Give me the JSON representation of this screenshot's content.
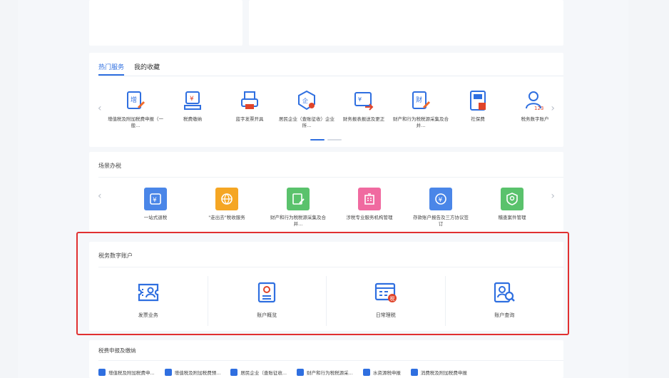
{
  "tabs": {
    "hot": "热门服务",
    "fav": "我的收藏"
  },
  "hot_items": [
    {
      "label": "增值税及附加税费申报（一般...",
      "icon": "tax-declare-icon"
    },
    {
      "label": "税费缴纳",
      "icon": "tax-payment-icon"
    },
    {
      "label": "蓝字发票开具",
      "icon": "invoice-print-icon"
    },
    {
      "label": "居民企业（查账征收）企业所...",
      "icon": "enterprise-tax-icon"
    },
    {
      "label": "财务报表报送及更正",
      "icon": "financial-report-icon"
    },
    {
      "label": "财产和行为税税源采集及合并...",
      "icon": "property-tax-icon"
    },
    {
      "label": "社保费",
      "icon": "social-security-icon"
    },
    {
      "label": "税务数字账户",
      "icon": "digital-account-icon"
    }
  ],
  "scene": {
    "title": "场景办税",
    "items": [
      {
        "label": "一站式退税",
        "color": "#4a86e8",
        "icon": "refund-icon"
      },
      {
        "label": "\"走出去\"税收服务",
        "color": "#f5a623",
        "icon": "global-icon"
      },
      {
        "label": "财产和行为税税源采集及合并...",
        "color": "#5ac26c",
        "icon": "property-collect-icon"
      },
      {
        "label": "涉税专业服务机构管理",
        "color": "#f06aa0",
        "icon": "institution-icon"
      },
      {
        "label": "存款账户报告及三方协议签订",
        "color": "#4a86e8",
        "icon": "bank-account-icon"
      },
      {
        "label": "稽查案件管理",
        "color": "#5ac26c",
        "icon": "case-icon"
      }
    ]
  },
  "digital": {
    "title": "税务数字账户",
    "items": [
      {
        "label": "发票业务",
        "icon": "invoice-business-icon"
      },
      {
        "label": "账户概览",
        "icon": "account-overview-icon"
      },
      {
        "label": "日常理税",
        "icon": "daily-tax-icon"
      },
      {
        "label": "账户查询",
        "icon": "account-query-icon"
      }
    ]
  },
  "tax_section": {
    "title": "税费申报及缴纳",
    "links": [
      "增值税及附加税费申...",
      "增值税及附加税费预...",
      "居民企业（查账征收...",
      "财产和行为税税源采...",
      "水资源税申报",
      "消费税及附加税费申报"
    ]
  },
  "colors": {
    "accent": "#2f6fe0",
    "highlight_border": "#e03030"
  }
}
